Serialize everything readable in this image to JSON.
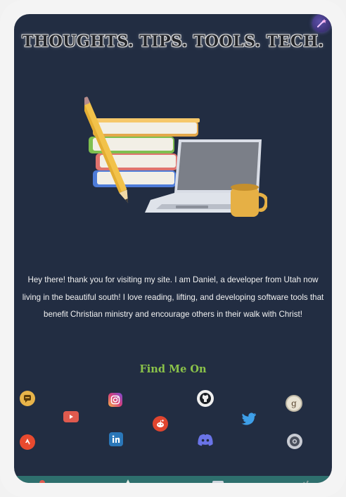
{
  "header": {
    "title": "THOUGHTS. TIPS. TOOLS. TECH."
  },
  "intro": {
    "text": "Hey there! thank you for visiting my site. I am Daniel, a developer from Utah now living in the beautiful south! I love reading, lifting, and developing software tools that benefit Christian ministry and encourage others in their walk with Christ!"
  },
  "social": {
    "heading": "Find Me On",
    "links": [
      {
        "name": "chat",
        "icon": "chat-icon",
        "color": "#e8b44a"
      },
      {
        "name": "instagram",
        "icon": "instagram-icon",
        "color": "#d6407a"
      },
      {
        "name": "github",
        "icon": "github-icon",
        "color": "#f0f0f0"
      },
      {
        "name": "goodreads",
        "icon": "goodreads-icon",
        "color": "#e9e3d3"
      },
      {
        "name": "youtube",
        "icon": "youtube-icon",
        "color": "#e05a4e"
      },
      {
        "name": "reddit",
        "icon": "reddit-icon",
        "color": "#e0452f"
      },
      {
        "name": "twitter",
        "icon": "twitter-icon",
        "color": "#3e9fe8"
      },
      {
        "name": "strava",
        "icon": "strava-icon",
        "color": "#e84a2f"
      },
      {
        "name": "linkedin",
        "icon": "linkedin-icon",
        "color": "#2a77b9"
      },
      {
        "name": "discord",
        "icon": "discord-icon",
        "color": "#6a74e8"
      },
      {
        "name": "steam",
        "icon": "steam-icon",
        "color": "#c8cbd3"
      }
    ]
  },
  "colors": {
    "background": "#222d42",
    "heading_accent": "#8bc34a",
    "bottom_bar": "#2e6f6d"
  }
}
